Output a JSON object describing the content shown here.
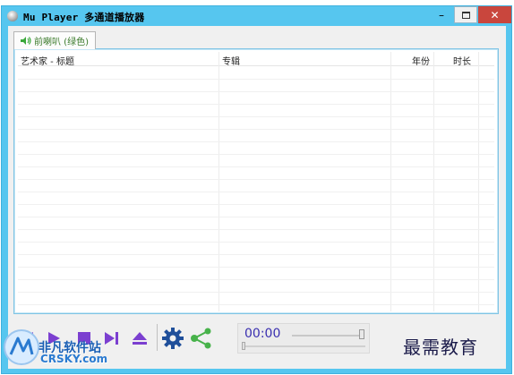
{
  "window": {
    "title": "Mu Player 多通道播放器",
    "minimize_glyph": "–",
    "close_glyph": "✕"
  },
  "tab": {
    "label": "前喇叭 (绿色)",
    "icon": "speaker-icon",
    "icon_color": "#3aa83a"
  },
  "playlist": {
    "columns": [
      "艺术家 - 标题",
      "专辑",
      "年份",
      "时长"
    ],
    "rows": []
  },
  "controls": {
    "time": "00:00",
    "volume_level": 1.0,
    "seek_position": 0.0,
    "buttons": [
      "previous-icon",
      "play-icon",
      "stop-icon",
      "next-icon",
      "eject-icon",
      "gear-icon",
      "share-icon"
    ],
    "accent": "#7b3fd0",
    "gear_color": "#1f4f9a",
    "share_color": "#47b24a"
  },
  "watermarks": {
    "left_main": "非凡软件站",
    "left_sub": "CRSKY.com",
    "right": "最需教育"
  }
}
